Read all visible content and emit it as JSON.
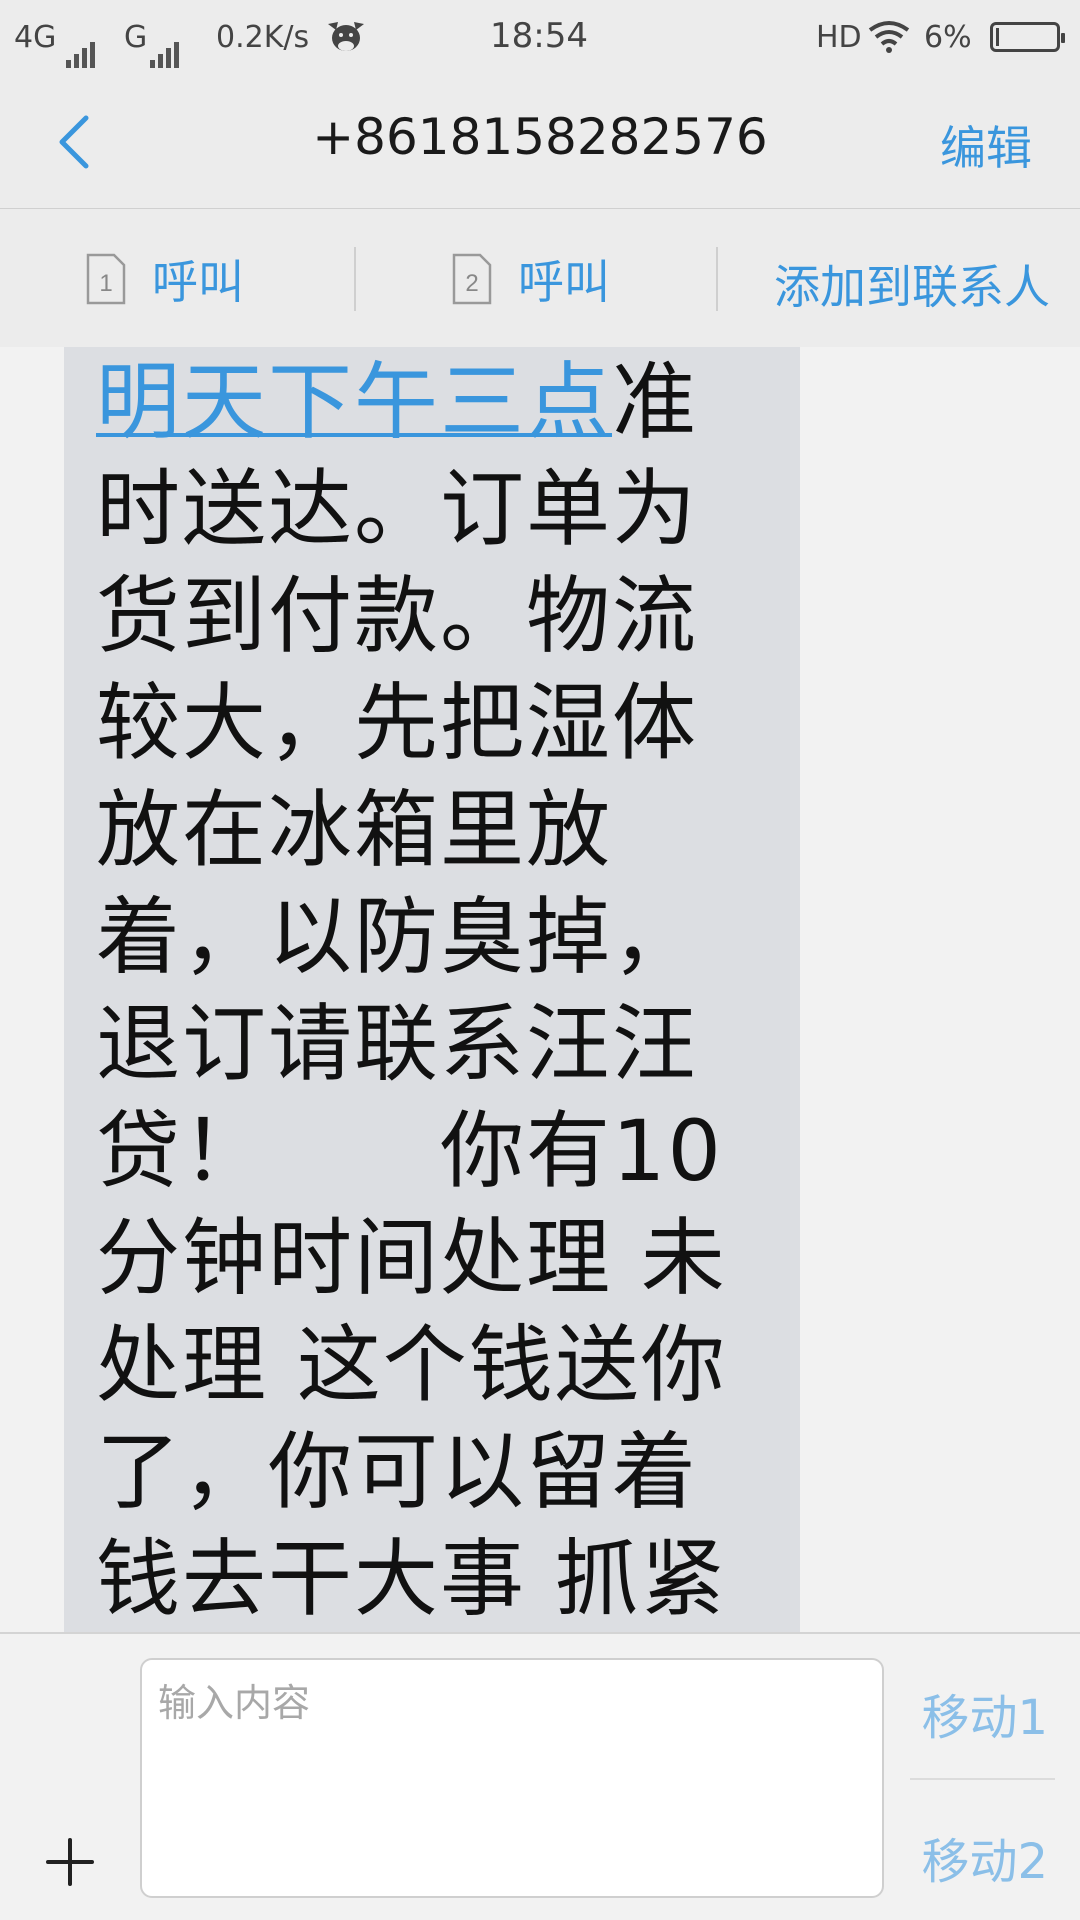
{
  "status_bar": {
    "network1": "4G",
    "network2": "G",
    "speed": "0.2K/s",
    "time": "18:54",
    "hd": "HD",
    "battery_text": "6%",
    "battery_level": 0.06
  },
  "header": {
    "title": "+8618158282576",
    "edit_label": "编辑"
  },
  "call_bar": {
    "sim1_number": "1",
    "sim1_label": "呼叫",
    "sim2_number": "2",
    "sim2_label": "呼叫",
    "add_contact_label": "添加到联系人"
  },
  "message": {
    "link_text": "明天下午三点",
    "body_text": "准时送达。订单为货到付款。物流较大，先把湿体放在冰箱里放着，以防臭掉，退订请联系汪汪贷！　　你有10分钟时间处理 未处理 这个钱送你了，你可以留着钱去干大事 抓紧时间，我会让你朋友"
  },
  "input": {
    "placeholder": "输入内容",
    "value": "",
    "send1_label": "移动1",
    "send2_label": "移动2"
  },
  "colors": {
    "accent": "#3a96dd",
    "accent_light": "#8bbfe8",
    "bubble": "#dcdee2",
    "background": "#f2f2f2"
  },
  "icons": {
    "back": "chevron-left-icon",
    "sim1": "sim-card-1-icon",
    "sim2": "sim-card-2-icon",
    "wifi": "wifi-icon",
    "signal": "signal-icon",
    "mascot": "cow-mascot-icon",
    "battery": "battery-icon",
    "add": "plus-icon"
  }
}
